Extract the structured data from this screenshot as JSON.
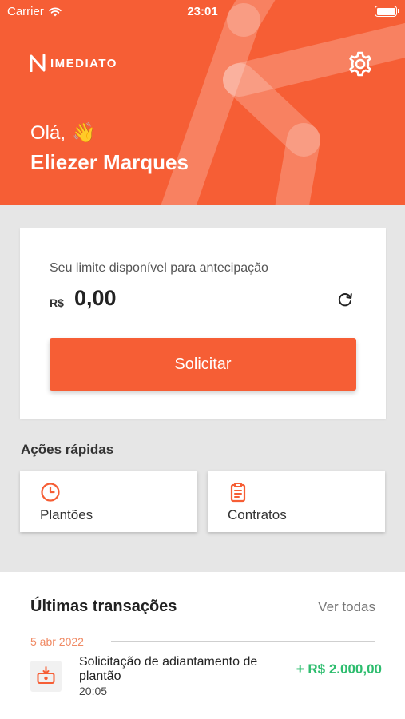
{
  "status_bar": {
    "carrier": "Carrier",
    "time": "23:01"
  },
  "header": {
    "logo_text": "IMEDIATO",
    "greeting": "Olá,",
    "greeting_emoji": "👋",
    "user_name": "Eliezer Marques",
    "icons": {
      "wifi": "wifi-icon",
      "battery": "battery-icon",
      "settings": "gear-icon",
      "logo": "imediato-logo-icon"
    }
  },
  "limit_card": {
    "label": "Seu limite disponível para antecipação",
    "currency": "R$",
    "amount": "0,00",
    "refresh_icon": "refresh-icon",
    "button_label": "Solicitar"
  },
  "quick_actions": {
    "title": "Ações rápidas",
    "items": [
      {
        "label": "Plantões",
        "icon": "clock-icon"
      },
      {
        "label": "Contratos",
        "icon": "clipboard-icon"
      }
    ]
  },
  "transactions": {
    "title": "Últimas transações",
    "see_all": "Ver todas",
    "groups": [
      {
        "date": "5 abr 2022",
        "items": [
          {
            "description": "Solicitação de adiantamento de plantão",
            "time": "20:05",
            "amount": "+ R$ 2.000,00",
            "icon": "money-download-icon"
          }
        ]
      }
    ]
  },
  "colors": {
    "brand": "#f65e35",
    "positive": "#2dbd6e",
    "date_accent": "#f08a64",
    "background": "#e6e6e6"
  }
}
